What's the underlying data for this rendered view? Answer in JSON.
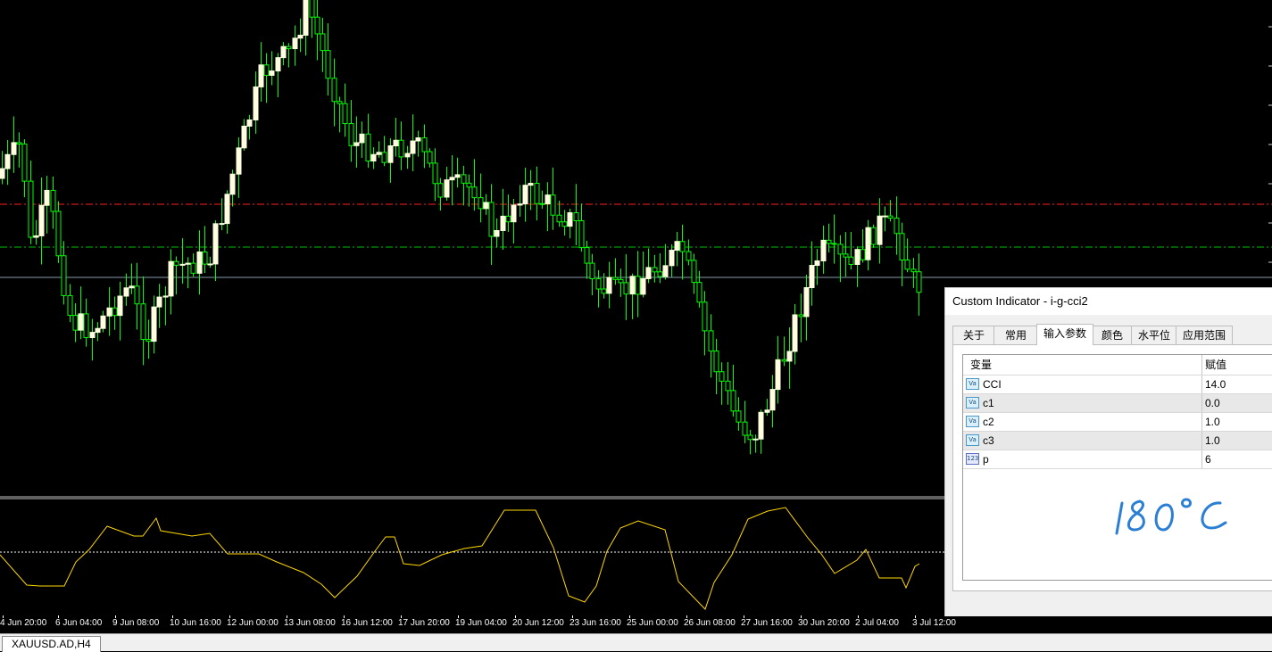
{
  "chart": {
    "symbol_tab": "XAUUSD.AD,H4",
    "colors": {
      "candle": "#00ff00",
      "candle_bull_fill": "#ffffe0",
      "level_red": "#ff2020",
      "level_green": "#00c000",
      "price_line": "#8899aa",
      "cci_line": "#ffd700"
    },
    "time_labels": [
      "4 Jun 20:00",
      "6 Jun 04:00",
      "9 Jun 08:00",
      "10 Jun 16:00",
      "12 Jun 00:00",
      "13 Jun 08:00",
      "16 Jun 12:00",
      "17 Jun 20:00",
      "19 Jun 04:00",
      "20 Jun 12:00",
      "23 Jun 16:00",
      "25 Jun 00:00",
      "26 Jun 08:00",
      "27 Jun 16:00",
      "30 Jun 20:00",
      "2 Jul 04:00",
      "3 Jul 12:00"
    ]
  },
  "dialog": {
    "title": "Custom Indicator - i-g-cci2",
    "tabs": [
      "关于",
      "常用",
      "输入参数",
      "颜色",
      "水平位",
      "应用范围"
    ],
    "active_tab": "输入参数",
    "columns": {
      "variable": "变量",
      "value": "赋值"
    },
    "params": [
      {
        "icon": "variable-double-icon",
        "name": "CCI",
        "value": "14.0"
      },
      {
        "icon": "variable-double-icon",
        "name": "c1",
        "value": "0.0"
      },
      {
        "icon": "variable-double-icon",
        "name": "c2",
        "value": "1.0"
      },
      {
        "icon": "variable-double-icon",
        "name": "c3",
        "value": "1.0"
      },
      {
        "icon": "variable-int-icon",
        "name": "p",
        "value": "6"
      }
    ],
    "icon_text": {
      "double": "Va",
      "int": "123"
    },
    "handwriting": "180°C"
  }
}
